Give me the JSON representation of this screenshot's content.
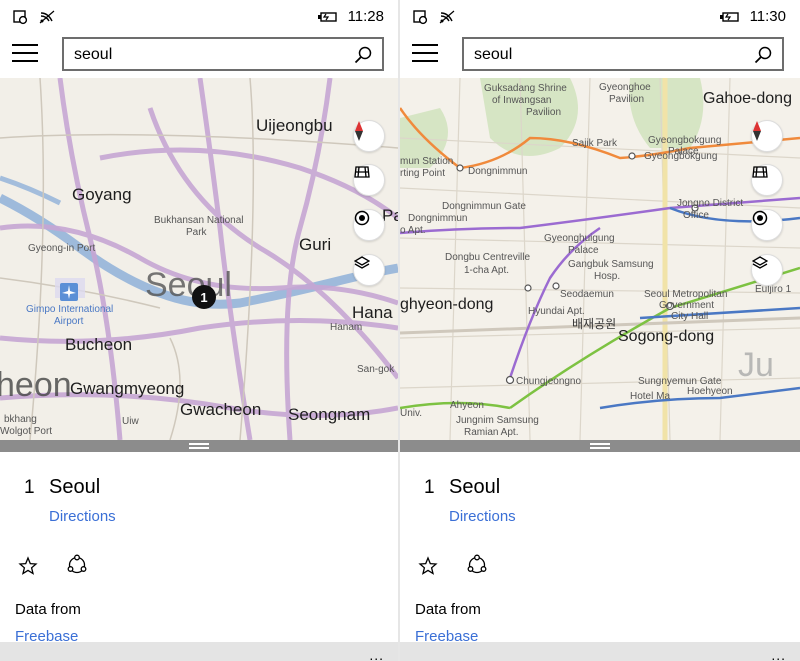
{
  "screens": [
    {
      "status": {
        "time": "11:28"
      },
      "search": {
        "value": "seoul"
      },
      "map": {
        "labels": {
          "uijeongbu": "Uijeongbu",
          "goyang": "Goyang",
          "bukhansan": "Bukhansan National",
          "park": "Park",
          "gyeongin": "Gyeong-in Port",
          "guri": "Guri",
          "seoul": "Seoul",
          "gimpo1": "Gimpo International",
          "gimpo2": "Airport",
          "bucheon": "Bucheon",
          "hanam_big": "Hana",
          "hanam_small": "Hanam",
          "heon": "heon",
          "gwangmyeong": "Gwangmyeong",
          "gwacheon": "Gwacheon",
          "seongnam": "Seongnam",
          "sangok": "San-gok",
          "bokhang": "bkhang",
          "wolgot": "Wolgot Port",
          "uiwang": "Uiw",
          "pal": "Pal",
          "pin": "1"
        }
      },
      "result": {
        "number": "1",
        "name": "Seoul",
        "directions": "Directions"
      },
      "attribution": {
        "label": "Data from",
        "source": "Freebase"
      },
      "appbar": {
        "more": "..."
      }
    },
    {
      "status": {
        "time": "11:30"
      },
      "search": {
        "value": "seoul"
      },
      "map": {
        "labels": {
          "guksadang1": "Guksadang Shrine",
          "guksadang2": "of Inwangsan",
          "guksadang3": "Pavilion",
          "gyeonghoe1": "Gyeonghoe",
          "gyeonghoe2": "Pavilion",
          "gahoedong": "Gahoe-dong",
          "sajik": "Sajik Park",
          "gyeongbok1": "Gyeongbokgung",
          "gyeongbok2": "Palace",
          "gyeongbok3": "Gyeongbokgung",
          "station1": "mun Station",
          "station2": "rting Point",
          "dongnimmun": "Dongnimmun",
          "jongno1": "Jongno District",
          "jongno2": "Office",
          "dongnimmun_gate": "Dongnimmun Gate",
          "dongnimmun2": "Dongnimmun",
          "apt1": "o Apt.",
          "gyeonghuigung1": "Gyeonghuigung",
          "gyeonghuigung2": "Palace",
          "centreville1": "Dongbu Centreville",
          "centreville2": "1-cha Apt.",
          "gangbuk1": "Gangbuk Samsung",
          "gangbuk2": "Hosp.",
          "seodaemun": "Seodaemun",
          "seoul_metro1": "Seoul Metropolitan",
          "seoul_metro2": "Government",
          "seoul_metro3": "City Hall",
          "euljiro": "Euljiro 1",
          "hyeondong": "ghyeon-dong",
          "hyundai": "Hyundai Apt.",
          "korean": "배재공원",
          "sogong": "Sogong-dong",
          "chungjeongno": "Chungjeongno",
          "sungnyemun": "Sungnyemun Gate",
          "hoehyeon": "Hoehyeon",
          "hotel": "Hotel Ma",
          "ahyeon": "Ahyeon",
          "jungnim1": "Jungnim Samsung",
          "jungnim2": "Ramian Apt.",
          "univ": "Univ.",
          "ju": "Ju"
        }
      },
      "result": {
        "number": "1",
        "name": "Seoul",
        "directions": "Directions"
      },
      "attribution": {
        "label": "Data from",
        "source": "Freebase"
      },
      "appbar": {
        "more": "..."
      }
    }
  ],
  "colors": {
    "accent": "#3a6fd6",
    "handle": "#8c8c8c",
    "appbar": "#e4e4e4"
  }
}
